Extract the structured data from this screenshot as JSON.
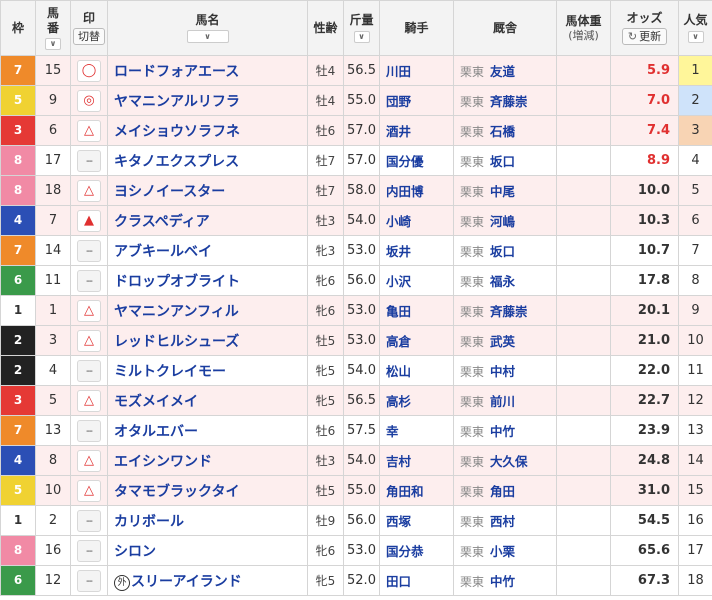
{
  "header": {
    "waku": "枠",
    "umaban_top": "馬",
    "umaban_bottom": "番",
    "mark": "印",
    "mark_toggle": "切替",
    "horse": "馬名",
    "sexage": "性齢",
    "kinryo": "斤量",
    "jockey": "騎手",
    "trainer": "厩舎",
    "weight_top": "馬体重",
    "weight_bottom": "(増減)",
    "odds": "オッズ",
    "odds_update": "更新",
    "pop_top": "人気",
    "sort_arrow": "∨"
  },
  "colors": {
    "waku1": "#ffffff",
    "waku2": "#222222",
    "waku3": "#e53935",
    "waku4": "#2b4fb5",
    "waku5": "#f0d232",
    "waku6": "#3a9a4a",
    "waku7": "#ef8a2a",
    "waku8": "#f18aa5",
    "link": "#1a3da0",
    "hot_odds": "#e03030"
  },
  "rows": [
    {
      "waku": "7",
      "umaban": "15",
      "mark": "◯",
      "horse": "ロードフォアエース",
      "foreign": "",
      "sexage": "牡4",
      "kinryo": "56.5",
      "jockey": "川田",
      "area": "栗東",
      "trainer": "友道",
      "odds": "5.9",
      "pop": "1",
      "marked": true,
      "hot": true
    },
    {
      "waku": "5",
      "umaban": "9",
      "mark": "◎",
      "horse": "ヤマニンアルリフラ",
      "foreign": "",
      "sexage": "牡4",
      "kinryo": "55.0",
      "jockey": "団野",
      "area": "栗東",
      "trainer": "斉藤崇",
      "odds": "7.0",
      "pop": "2",
      "marked": true,
      "hot": true
    },
    {
      "waku": "3",
      "umaban": "6",
      "mark": "△",
      "horse": "メイショウソラフネ",
      "foreign": "",
      "sexage": "牡6",
      "kinryo": "57.0",
      "jockey": "酒井",
      "area": "栗東",
      "trainer": "石橋",
      "odds": "7.4",
      "pop": "3",
      "marked": true,
      "hot": true
    },
    {
      "waku": "8",
      "umaban": "17",
      "mark": "--",
      "horse": "キタノエクスプレス",
      "foreign": "",
      "sexage": "牡7",
      "kinryo": "57.0",
      "jockey": "国分優",
      "area": "栗東",
      "trainer": "坂口",
      "odds": "8.9",
      "pop": "4",
      "marked": false,
      "hot": true
    },
    {
      "waku": "8",
      "umaban": "18",
      "mark": "△",
      "horse": "ヨシノイースター",
      "foreign": "",
      "sexage": "牡7",
      "kinryo": "58.0",
      "jockey": "内田博",
      "area": "栗東",
      "trainer": "中尾",
      "odds": "10.0",
      "pop": "5",
      "marked": true,
      "hot": false
    },
    {
      "waku": "4",
      "umaban": "7",
      "mark": "▲",
      "horse": "クラスペディア",
      "foreign": "",
      "sexage": "牡3",
      "kinryo": "54.0",
      "jockey": "小崎",
      "area": "栗東",
      "trainer": "河嶋",
      "odds": "10.3",
      "pop": "6",
      "marked": true,
      "hot": false
    },
    {
      "waku": "7",
      "umaban": "14",
      "mark": "--",
      "horse": "アブキールベイ",
      "foreign": "",
      "sexage": "牝3",
      "kinryo": "53.0",
      "jockey": "坂井",
      "area": "栗東",
      "trainer": "坂口",
      "odds": "10.7",
      "pop": "7",
      "marked": false,
      "hot": false
    },
    {
      "waku": "6",
      "umaban": "11",
      "mark": "--",
      "horse": "ドロップオブライト",
      "foreign": "",
      "sexage": "牝6",
      "kinryo": "56.0",
      "jockey": "小沢",
      "area": "栗東",
      "trainer": "福永",
      "odds": "17.8",
      "pop": "8",
      "marked": false,
      "hot": false
    },
    {
      "waku": "1",
      "umaban": "1",
      "mark": "△",
      "horse": "ヤマニンアンフィル",
      "foreign": "",
      "sexage": "牝6",
      "kinryo": "53.0",
      "jockey": "亀田",
      "area": "栗東",
      "trainer": "斉藤崇",
      "odds": "20.1",
      "pop": "9",
      "marked": true,
      "hot": false
    },
    {
      "waku": "2",
      "umaban": "3",
      "mark": "△",
      "horse": "レッドヒルシューズ",
      "foreign": "",
      "sexage": "牡5",
      "kinryo": "53.0",
      "jockey": "高倉",
      "area": "栗東",
      "trainer": "武英",
      "odds": "21.0",
      "pop": "10",
      "marked": true,
      "hot": false
    },
    {
      "waku": "2",
      "umaban": "4",
      "mark": "--",
      "horse": "ミルトクレイモー",
      "foreign": "",
      "sexage": "牝5",
      "kinryo": "54.0",
      "jockey": "松山",
      "area": "栗東",
      "trainer": "中村",
      "odds": "22.0",
      "pop": "11",
      "marked": false,
      "hot": false
    },
    {
      "waku": "3",
      "umaban": "5",
      "mark": "△",
      "horse": "モズメイメイ",
      "foreign": "",
      "sexage": "牝5",
      "kinryo": "56.5",
      "jockey": "高杉",
      "area": "栗東",
      "trainer": "前川",
      "odds": "22.7",
      "pop": "12",
      "marked": true,
      "hot": false
    },
    {
      "waku": "7",
      "umaban": "13",
      "mark": "--",
      "horse": "オタルエバー",
      "foreign": "",
      "sexage": "牡6",
      "kinryo": "57.5",
      "jockey": "幸",
      "area": "栗東",
      "trainer": "中竹",
      "odds": "23.9",
      "pop": "13",
      "marked": false,
      "hot": false
    },
    {
      "waku": "4",
      "umaban": "8",
      "mark": "△",
      "horse": "エイシンワンド",
      "foreign": "",
      "sexage": "牡3",
      "kinryo": "54.0",
      "jockey": "吉村",
      "area": "栗東",
      "trainer": "大久保",
      "odds": "24.8",
      "pop": "14",
      "marked": true,
      "hot": false
    },
    {
      "waku": "5",
      "umaban": "10",
      "mark": "△",
      "horse": "タマモブラックタイ",
      "foreign": "",
      "sexage": "牡5",
      "kinryo": "55.0",
      "jockey": "角田和",
      "area": "栗東",
      "trainer": "角田",
      "odds": "31.0",
      "pop": "15",
      "marked": true,
      "hot": false
    },
    {
      "waku": "1",
      "umaban": "2",
      "mark": "--",
      "horse": "カリボール",
      "foreign": "",
      "sexage": "牡9",
      "kinryo": "56.0",
      "jockey": "西塚",
      "area": "栗東",
      "trainer": "西村",
      "odds": "54.5",
      "pop": "16",
      "marked": false,
      "hot": false
    },
    {
      "waku": "8",
      "umaban": "16",
      "mark": "--",
      "horse": "シロン",
      "foreign": "",
      "sexage": "牝6",
      "kinryo": "53.0",
      "jockey": "国分恭",
      "area": "栗東",
      "trainer": "小栗",
      "odds": "65.6",
      "pop": "17",
      "marked": false,
      "hot": false
    },
    {
      "waku": "6",
      "umaban": "12",
      "mark": "--",
      "horse": "スリーアイランド",
      "foreign": "外",
      "sexage": "牝5",
      "kinryo": "52.0",
      "jockey": "田口",
      "area": "栗東",
      "trainer": "中竹",
      "odds": "67.3",
      "pop": "18",
      "marked": false,
      "hot": false
    }
  ]
}
